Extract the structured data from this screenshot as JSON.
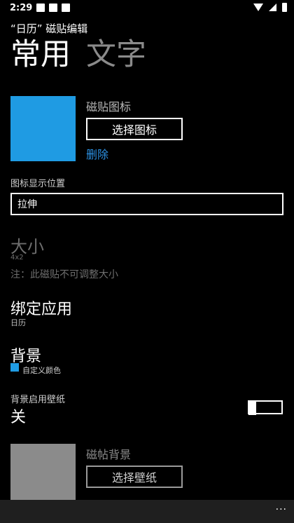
{
  "status_bar": {
    "time": "2:29"
  },
  "app": {
    "title": "“日历” 磁贴编辑"
  },
  "pivot": {
    "tabs": [
      {
        "label": "常用"
      },
      {
        "label": "文字"
      }
    ]
  },
  "tile_icon": {
    "label": "磁贴图标",
    "tile_color": "#1f9be3",
    "choose_button": "选择图标",
    "delete_link": "删除"
  },
  "icon_position": {
    "label": "图标显示位置",
    "value": "拉伸"
  },
  "size": {
    "title": "大小",
    "value": "4x2",
    "note": "注：此磁贴不可调整大小"
  },
  "bound_app": {
    "title": "绑定应用",
    "value": "日历"
  },
  "background": {
    "title": "背景",
    "option": "自定义颜色",
    "color": "#1f9be3"
  },
  "wallpaper": {
    "label": "背景启用壁纸",
    "state": "关",
    "enabled": false
  },
  "tile_background": {
    "label": "磁帖背景",
    "choose_button": "选择壁纸",
    "tile_color": "#8b8b8b"
  },
  "app_bar": {
    "more": "..."
  }
}
